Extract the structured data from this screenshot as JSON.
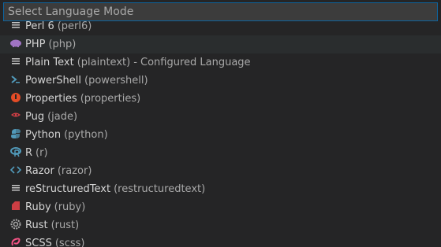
{
  "search": {
    "placeholder": "Select Language Mode"
  },
  "items": [
    {
      "label": "Perl 6",
      "id": "(perl6)",
      "note": "",
      "icon": "lines-icon"
    },
    {
      "label": "PHP",
      "id": "(php)",
      "note": "",
      "icon": "php-icon"
    },
    {
      "label": "Plain Text",
      "id": "(plaintext)",
      "note": "- Configured Language",
      "icon": "lines-icon"
    },
    {
      "label": "PowerShell",
      "id": "(powershell)",
      "note": "",
      "icon": "terminal-icon"
    },
    {
      "label": "Properties",
      "id": "(properties)",
      "note": "",
      "icon": "properties-icon"
    },
    {
      "label": "Pug",
      "id": "(jade)",
      "note": "",
      "icon": "pug-icon"
    },
    {
      "label": "Python",
      "id": "(python)",
      "note": "",
      "icon": "python-icon"
    },
    {
      "label": "R",
      "id": "(r)",
      "note": "",
      "icon": "r-icon"
    },
    {
      "label": "Razor",
      "id": "(razor)",
      "note": "",
      "icon": "code-icon"
    },
    {
      "label": "reStructuredText",
      "id": "(restructuredtext)",
      "note": "",
      "icon": "lines-icon"
    },
    {
      "label": "Ruby",
      "id": "(ruby)",
      "note": "",
      "icon": "ruby-icon"
    },
    {
      "label": "Rust",
      "id": "(rust)",
      "note": "",
      "icon": "rust-icon"
    },
    {
      "label": "SCSS",
      "id": "(scss)",
      "note": "",
      "icon": "scss-icon"
    }
  ],
  "colors": {
    "background": "#252526",
    "input_background": "#3c3c3c",
    "input_border": "#0e639c",
    "text": "#d4d4d4",
    "secondary_text": "#a9a9a9"
  }
}
